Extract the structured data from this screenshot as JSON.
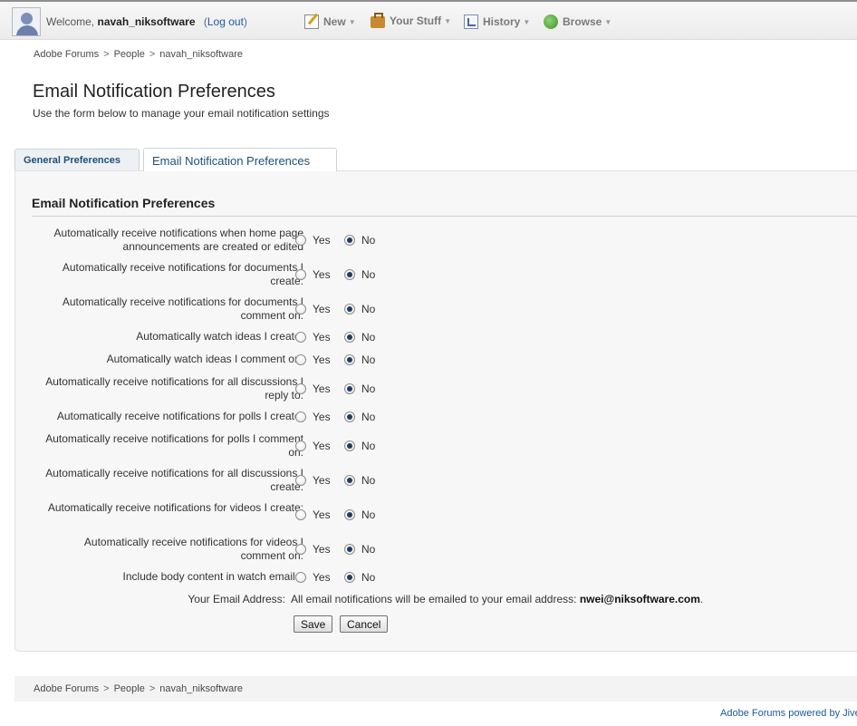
{
  "user": {
    "welcome_prefix": "Welcome,",
    "username": "navah_niksoftware",
    "logout_label": "Log out"
  },
  "nav": {
    "new_label": "New",
    "your_stuff_label": "Your Stuff",
    "history_label": "History",
    "browse_label": "Browse"
  },
  "breadcrumb": {
    "items": [
      "Adobe Forums",
      "People",
      "navah_niksoftware"
    ],
    "separator": ">"
  },
  "header": {
    "title": "Email Notification Preferences",
    "subtitle": "Use the form below to manage your email notification settings"
  },
  "tabs": [
    {
      "label": "General Preferences",
      "active": false
    },
    {
      "label": "Email Notification Preferences",
      "active": true
    }
  ],
  "form": {
    "section_title": "Email Notification Preferences",
    "yes_label": "Yes",
    "no_label": "No",
    "rows": [
      {
        "label": "Automatically receive notifications when home page announcements are created or edited",
        "selected": "No"
      },
      {
        "label": "Automatically receive notifications for documents I create:",
        "selected": "No"
      },
      {
        "label": "Automatically receive notifications for documents I comment on:",
        "selected": "No"
      },
      {
        "label": "Automatically watch ideas I create:",
        "selected": "No"
      },
      {
        "label": "Automatically watch ideas I comment on:",
        "selected": "No"
      },
      {
        "label": "Automatically receive notifications for all discussions I reply to:",
        "selected": "No"
      },
      {
        "label": "Automatically receive notifications for polls I create:",
        "selected": "No"
      },
      {
        "label": "Automatically receive notifications for polls I comment on:",
        "selected": "No"
      },
      {
        "label": "Automatically receive notifications for all discussions I create:",
        "selected": "No"
      },
      {
        "label": "Automatically receive notifications for videos I create:",
        "selected": "No"
      },
      {
        "label": "Automatically receive notifications for videos I comment on:",
        "selected": "No"
      },
      {
        "label": "Include body content in watch emails:",
        "selected": "No"
      }
    ],
    "email_label": "Your Email Address:",
    "email_text": "All email notifications will be emailed to your email address:",
    "email_value": "nwei@niksoftware.com",
    "email_period": ".",
    "save_label": "Save",
    "cancel_label": "Cancel"
  },
  "footer": {
    "powered_by": "Adobe Forums powered by Jive"
  },
  "colors": {
    "link": "#1d5aa0",
    "tab_text": "#1d4f78",
    "radio_selected": "#1f3c63"
  }
}
